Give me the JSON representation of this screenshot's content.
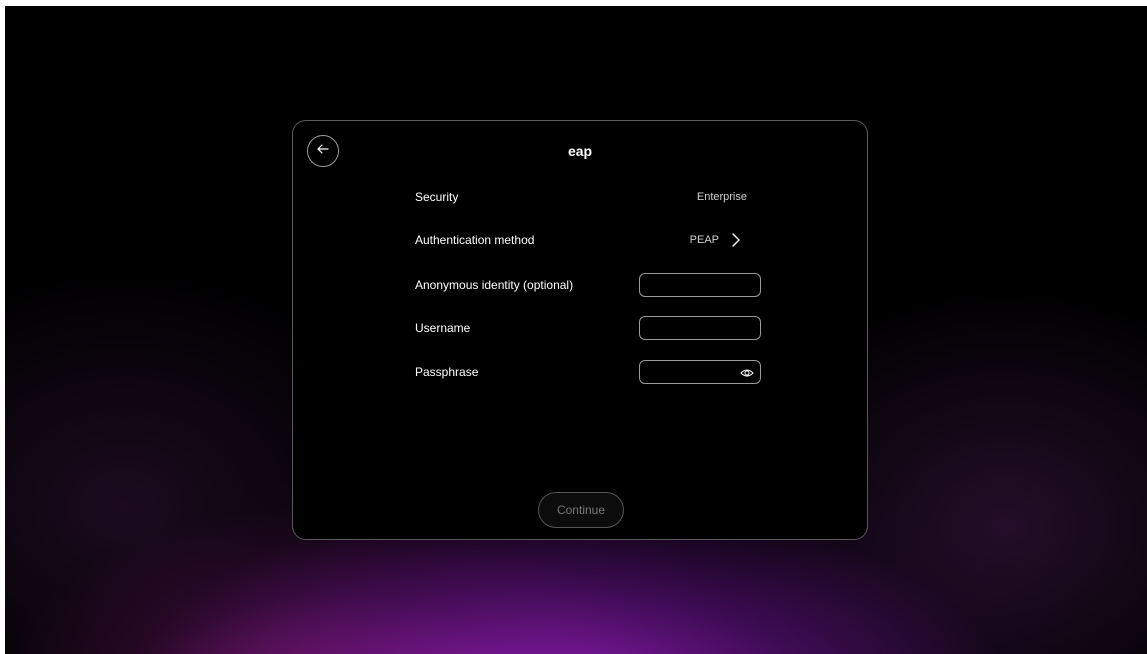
{
  "dialog": {
    "title": "eap",
    "back_icon": "arrow-left-icon"
  },
  "rows": {
    "security": {
      "label": "Security",
      "value": "Enterprise"
    },
    "auth_method": {
      "label": "Authentication method",
      "value": "PEAP",
      "icon": "chevron-right-icon"
    },
    "anonymous_identity": {
      "label": "Anonymous identity (optional)",
      "value": ""
    },
    "username": {
      "label": "Username",
      "value": ""
    },
    "passphrase": {
      "label": "Passphrase",
      "value": "",
      "icon": "eye-icon"
    }
  },
  "footer": {
    "continue_label": "Continue",
    "continue_state": "disabled"
  },
  "colors": {
    "background": "#000000",
    "glow_purple": "#961ebe",
    "glow_magenta": "#be2878",
    "text": "#ffffff",
    "border": "#9a9a9a"
  }
}
